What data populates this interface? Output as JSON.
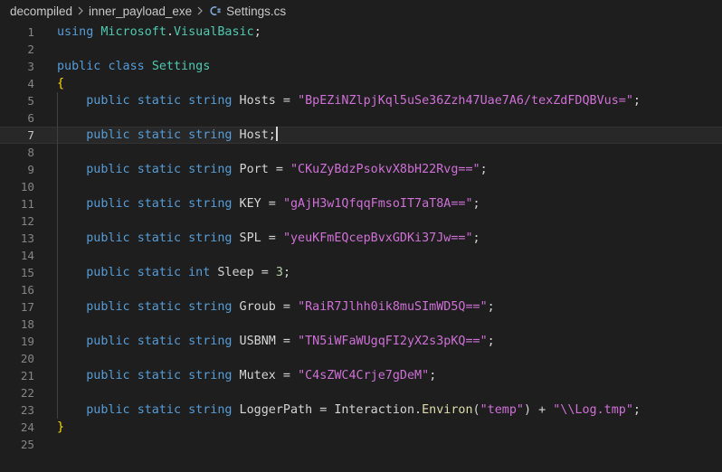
{
  "breadcrumb": {
    "items": [
      "decompiled",
      "inner_payload_exe"
    ],
    "file": "Settings.cs",
    "file_icon": "csharp-icon",
    "separator_icon": "chevron-right-icon"
  },
  "colors": {
    "background": "#1e1e1e",
    "keyword": "#569cd6",
    "type": "#4ec9b0",
    "string": "#ce70d6",
    "number": "#b5cea8",
    "brace": "#ffd700"
  },
  "editor": {
    "current_line": 7,
    "lines": [
      {
        "n": "1",
        "tokens": [
          [
            "kw",
            "using"
          ],
          [
            "t",
            " "
          ],
          [
            "ns",
            "Microsoft"
          ],
          [
            "t",
            "."
          ],
          [
            "ns",
            "VisualBasic"
          ],
          [
            "t",
            ";"
          ]
        ]
      },
      {
        "n": "2",
        "tokens": []
      },
      {
        "n": "3",
        "tokens": [
          [
            "kw",
            "public"
          ],
          [
            "t",
            " "
          ],
          [
            "kw",
            "class"
          ],
          [
            "t",
            " "
          ],
          [
            "type",
            "Settings"
          ]
        ]
      },
      {
        "n": "4",
        "tokens": [
          [
            "brace",
            "{"
          ]
        ]
      },
      {
        "n": "5",
        "tokens": [
          [
            "t",
            "    "
          ],
          [
            "kw",
            "public"
          ],
          [
            "t",
            " "
          ],
          [
            "kw",
            "static"
          ],
          [
            "t",
            " "
          ],
          [
            "kw",
            "string"
          ],
          [
            "t",
            " Hosts = "
          ],
          [
            "str",
            "\"BpEZiNZlpjKql5uSe36Zzh47Uae7A6/texZdFDQBVus=\""
          ],
          [
            "t",
            ";"
          ]
        ]
      },
      {
        "n": "6",
        "tokens": []
      },
      {
        "n": "7",
        "tokens": [
          [
            "t",
            "    "
          ],
          [
            "kw",
            "public"
          ],
          [
            "t",
            " "
          ],
          [
            "kw",
            "static"
          ],
          [
            "t",
            " "
          ],
          [
            "kw",
            "string"
          ],
          [
            "t",
            " Host;"
          ]
        ]
      },
      {
        "n": "8",
        "tokens": []
      },
      {
        "n": "9",
        "tokens": [
          [
            "t",
            "    "
          ],
          [
            "kw",
            "public"
          ],
          [
            "t",
            " "
          ],
          [
            "kw",
            "static"
          ],
          [
            "t",
            " "
          ],
          [
            "kw",
            "string"
          ],
          [
            "t",
            " Port = "
          ],
          [
            "str",
            "\"CKuZyBdzPsokvX8bH22Rvg==\""
          ],
          [
            "t",
            ";"
          ]
        ]
      },
      {
        "n": "10",
        "tokens": []
      },
      {
        "n": "11",
        "tokens": [
          [
            "t",
            "    "
          ],
          [
            "kw",
            "public"
          ],
          [
            "t",
            " "
          ],
          [
            "kw",
            "static"
          ],
          [
            "t",
            " "
          ],
          [
            "kw",
            "string"
          ],
          [
            "t",
            " KEY = "
          ],
          [
            "str",
            "\"gAjH3w1QfqqFmsoIT7aT8A==\""
          ],
          [
            "t",
            ";"
          ]
        ]
      },
      {
        "n": "12",
        "tokens": []
      },
      {
        "n": "13",
        "tokens": [
          [
            "t",
            "    "
          ],
          [
            "kw",
            "public"
          ],
          [
            "t",
            " "
          ],
          [
            "kw",
            "static"
          ],
          [
            "t",
            " "
          ],
          [
            "kw",
            "string"
          ],
          [
            "t",
            " SPL = "
          ],
          [
            "str",
            "\"yeuKFmEQcepBvxGDKi37Jw==\""
          ],
          [
            "t",
            ";"
          ]
        ]
      },
      {
        "n": "14",
        "tokens": []
      },
      {
        "n": "15",
        "tokens": [
          [
            "t",
            "    "
          ],
          [
            "kw",
            "public"
          ],
          [
            "t",
            " "
          ],
          [
            "kw",
            "static"
          ],
          [
            "t",
            " "
          ],
          [
            "kw",
            "int"
          ],
          [
            "t",
            " Sleep = "
          ],
          [
            "num",
            "3"
          ],
          [
            "t",
            ";"
          ]
        ]
      },
      {
        "n": "16",
        "tokens": []
      },
      {
        "n": "17",
        "tokens": [
          [
            "t",
            "    "
          ],
          [
            "kw",
            "public"
          ],
          [
            "t",
            " "
          ],
          [
            "kw",
            "static"
          ],
          [
            "t",
            " "
          ],
          [
            "kw",
            "string"
          ],
          [
            "t",
            " Groub = "
          ],
          [
            "str",
            "\"RaiR7Jlhh0ik8muSImWD5Q==\""
          ],
          [
            "t",
            ";"
          ]
        ]
      },
      {
        "n": "18",
        "tokens": []
      },
      {
        "n": "19",
        "tokens": [
          [
            "t",
            "    "
          ],
          [
            "kw",
            "public"
          ],
          [
            "t",
            " "
          ],
          [
            "kw",
            "static"
          ],
          [
            "t",
            " "
          ],
          [
            "kw",
            "string"
          ],
          [
            "t",
            " USBNM = "
          ],
          [
            "str",
            "\"TN5iWFaWUgqFI2yX2s3pKQ==\""
          ],
          [
            "t",
            ";"
          ]
        ]
      },
      {
        "n": "20",
        "tokens": []
      },
      {
        "n": "21",
        "tokens": [
          [
            "t",
            "    "
          ],
          [
            "kw",
            "public"
          ],
          [
            "t",
            " "
          ],
          [
            "kw",
            "static"
          ],
          [
            "t",
            " "
          ],
          [
            "kw",
            "string"
          ],
          [
            "t",
            " Mutex = "
          ],
          [
            "str",
            "\"C4sZWC4Crje7gDeM\""
          ],
          [
            "t",
            ";"
          ]
        ]
      },
      {
        "n": "22",
        "tokens": []
      },
      {
        "n": "23",
        "tokens": [
          [
            "t",
            "    "
          ],
          [
            "kw",
            "public"
          ],
          [
            "t",
            " "
          ],
          [
            "kw",
            "static"
          ],
          [
            "t",
            " "
          ],
          [
            "kw",
            "string"
          ],
          [
            "t",
            " LoggerPath = Interaction."
          ],
          [
            "fn",
            "Environ"
          ],
          [
            "t",
            "("
          ],
          [
            "str",
            "\"temp\""
          ],
          [
            "t",
            ") + "
          ],
          [
            "str",
            "\"\\\\Log.tmp\""
          ],
          [
            "t",
            ";"
          ]
        ]
      },
      {
        "n": "24",
        "tokens": [
          [
            "brace",
            "}"
          ]
        ]
      },
      {
        "n": "25",
        "tokens": []
      }
    ]
  }
}
